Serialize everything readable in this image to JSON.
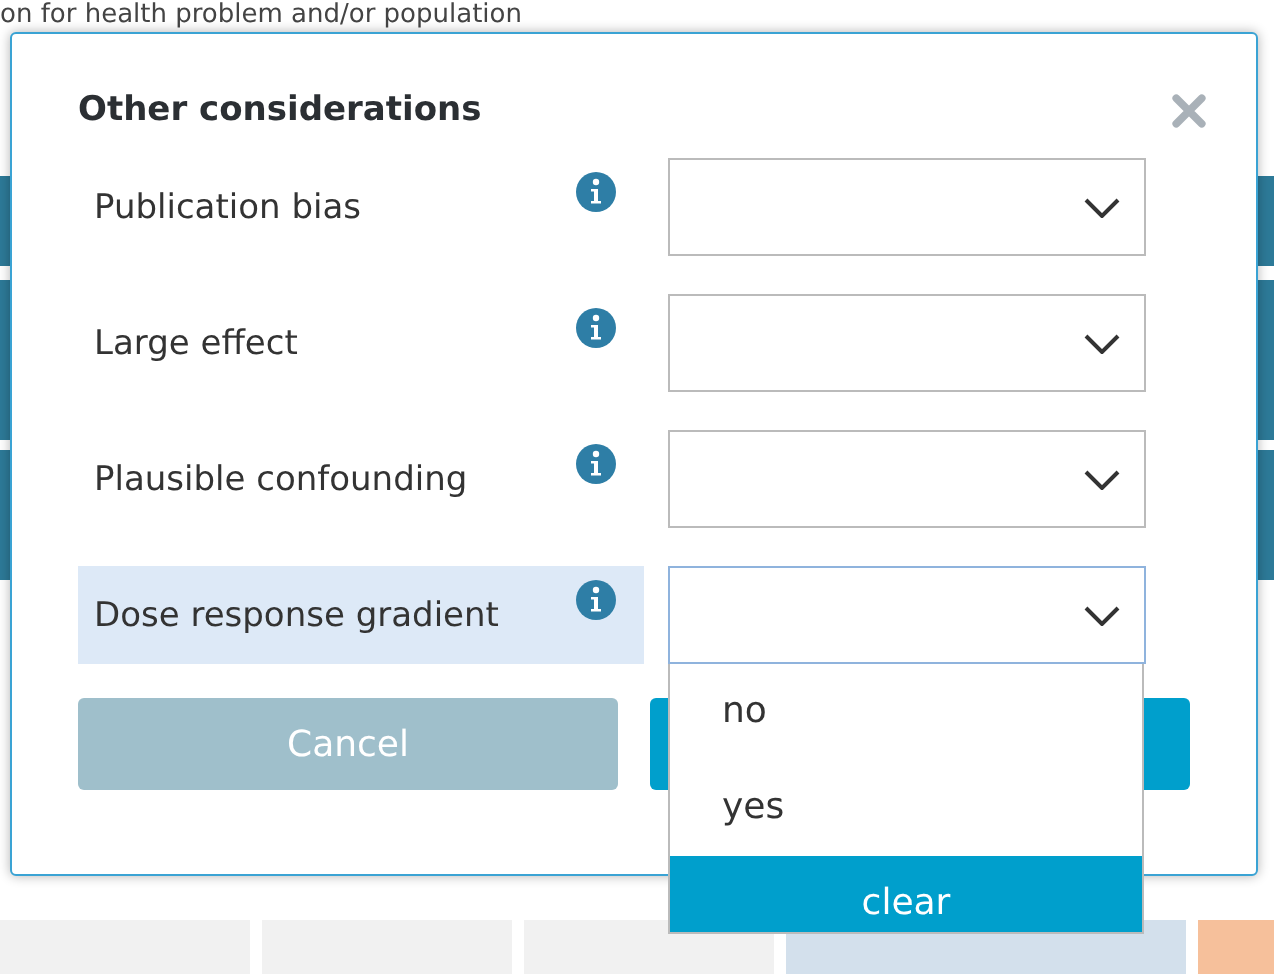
{
  "background_text": "on for health problem and/or population",
  "dialog": {
    "title": "Other considerations",
    "fields": [
      {
        "label": "Publication bias",
        "highlighted": false,
        "open": false
      },
      {
        "label": "Large effect",
        "highlighted": false,
        "open": false
      },
      {
        "label": "Plausible confounding",
        "highlighted": false,
        "open": false
      },
      {
        "label": "Dose response gradient",
        "highlighted": true,
        "open": true
      }
    ],
    "dropdown_options": [
      {
        "label": "no",
        "selected": false
      },
      {
        "label": "yes",
        "selected": false
      },
      {
        "label": "clear",
        "selected": true
      }
    ],
    "buttons": [
      {
        "label": "Cancel",
        "kind": "cancel"
      },
      {
        "kind": "primary"
      }
    ]
  }
}
